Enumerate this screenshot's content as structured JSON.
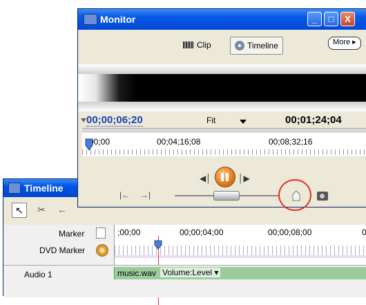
{
  "timeline_window": {
    "title": "Timeline",
    "tools": [
      "selection-arrow",
      "razor",
      "rolling"
    ],
    "marker_label": "Marker",
    "dvd_marker_label": "DVD Marker",
    "ruler_times": [
      ";00;00",
      "00;00;04;00",
      "00;00;08;00",
      "0"
    ],
    "audio_track_label": "Audio 1",
    "audio_clip_name": "music.wav",
    "audio_clip_property": "Volume:Level ▾"
  },
  "monitor": {
    "title": "Monitor",
    "tabs": {
      "clip": "Clip",
      "timeline": "Timeline"
    },
    "more_button": "More ▸",
    "current_timecode": "00;00;06;20",
    "zoom": "Fit",
    "duration_timecode": "00;01;24;04",
    "ruler_times": [
      "00;00",
      "00;04;16;08",
      "00;08;32;16"
    ],
    "window_buttons": {
      "minimize": "_",
      "maximize": "□",
      "close": "X"
    },
    "controls": {
      "step_back": "◀│",
      "step_forward": "│▶",
      "mark_in": "|←",
      "mark_out": "→|"
    }
  },
  "colors": {
    "title_bar": "#0055e5",
    "highlight_circle": "#e0322c",
    "audio_clip": "#9bcc9b",
    "play_button": "#e0781a",
    "timecode_link": "#1a3fb0"
  }
}
